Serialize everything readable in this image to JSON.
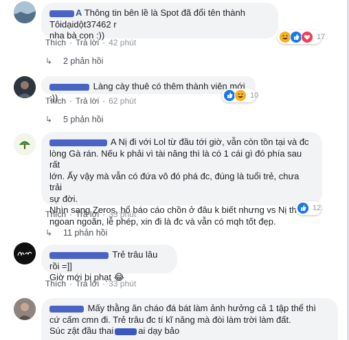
{
  "colors": {
    "link_blue": "#385898",
    "bubble_bg": "#f2f3f5",
    "meta_gray": "#90949c",
    "redact_blue": "#3b57c4"
  },
  "labels": {
    "like": "Thích",
    "reply": "Trả lời",
    "dot": "·"
  },
  "comments": [
    {
      "avatar_icon": "landscape-avatar-icon",
      "lines": [
        "Thông tin bên lề là Spot đã đổi tên thành Tôidạidột37462 r",
        "nha bà con :))"
      ],
      "time": "42 phút",
      "reactions": {
        "icons": [
          "haha-icon",
          "like-icon",
          "love-icon"
        ],
        "count": "17"
      },
      "replies": "2 phản hồi"
    },
    {
      "avatar_icon": "person-avatar-icon",
      "lines": [
        "Làng cày thuê có thêm thành viên mới :))"
      ],
      "time": "62 phút",
      "reactions": {
        "icons": [
          "like-icon",
          "haha-icon"
        ],
        "count": "10"
      },
      "replies": "5 phản hồi"
    },
    {
      "avatar_icon": "tree-logo-avatar-icon",
      "lines": [
        "A Nị đi với Lol từ đầu tới giờ, vẫn còn tồn tại và đc",
        "lòng Gà rán. Nếu k phải vì tài năng thì là có 1 cái gì đó phía sau rất",
        "lớn. Ấy vậy mà vẫn có đứa vô đó phá đc, đúng là tuổi trẻ, chưa trải",
        "sự đời.",
        "Nhìn sang Zeros, hổ báo cáo chồn ở đâu k biết nhưng vs Nị thì",
        "ngoan ngoãn, lễ phép, xin đi là đc và vẫn có mqh tốt đẹp."
      ],
      "time": "35 phút",
      "reactions": {
        "icons": [
          "like-icon"
        ],
        "count": "12"
      },
      "replies": "11 phản hồi"
    },
    {
      "avatar_icon": "signature-logo-avatar-icon",
      "lines": [
        "Trẻ trâu lâu rồi =]]",
        "Giờ mới bị phạt"
      ],
      "emoji": "😂",
      "time": "33 phút"
    },
    {
      "avatar_icon": "photo-avatar-icon",
      "lines": [
        "Mấy thằng ăn cháo đá bát làm ảnh hưởng cả 1 tập thể thì",
        "cứ cấm cmn đi. Trẻ trâu đc tí kĩ năng mà đòi làm trời làm đất.",
        "Súc zật đầu thai",
        "ai dạy bảo"
      ]
    }
  ]
}
